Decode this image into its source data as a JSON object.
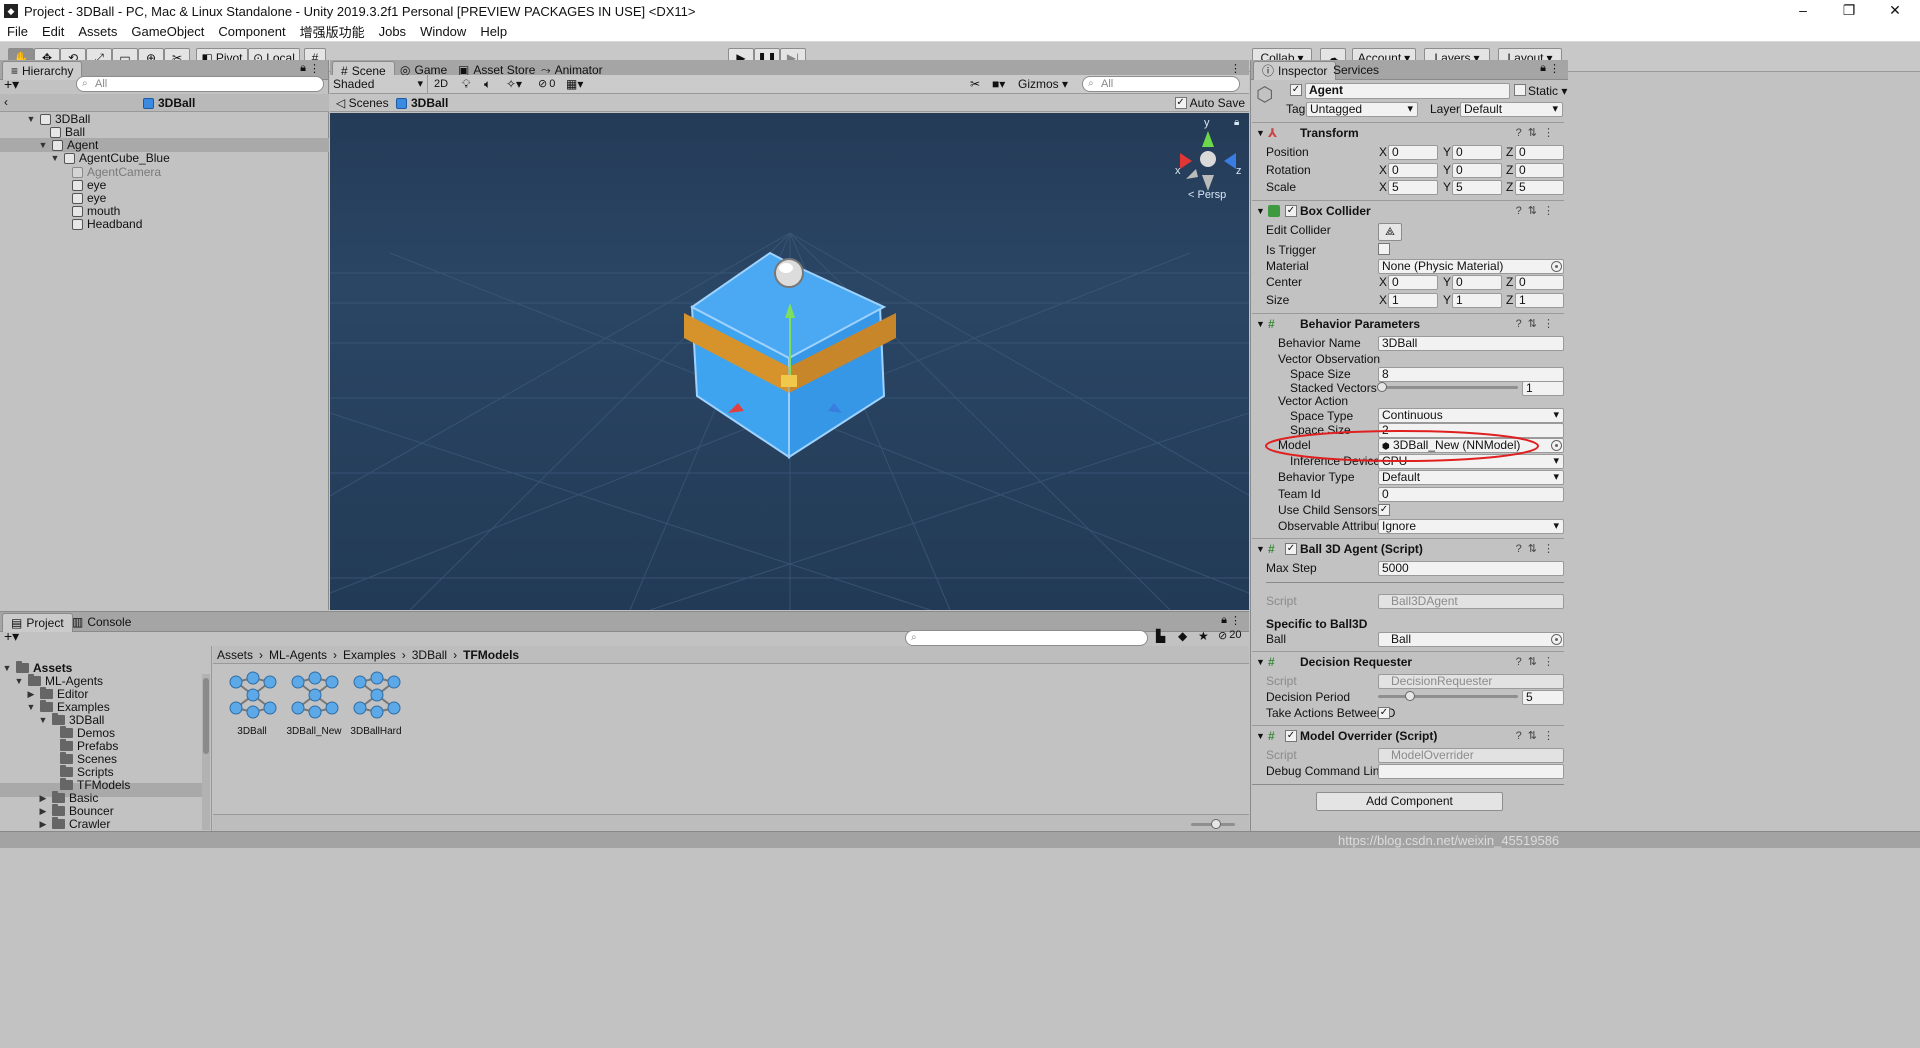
{
  "window": {
    "title": "Project - 3DBall - PC, Mac & Linux Standalone - Unity 2019.3.2f1 Personal [PREVIEW PACKAGES IN USE] <DX11>",
    "controls": [
      "–",
      "❐",
      "✕"
    ]
  },
  "menu": [
    "File",
    "Edit",
    "Assets",
    "GameObject",
    "Component",
    "增强版功能",
    "Jobs",
    "Window",
    "Help"
  ],
  "toolbar": {
    "pivot": "Pivot",
    "local": "Local",
    "collab": "Collab",
    "account": "Account",
    "layers": "Layers",
    "layout": "Layout"
  },
  "hierarchy": {
    "tab": "Hierarchy",
    "search_placeholder": "All",
    "scene_name": "3DBall",
    "rows": [
      {
        "label": "3DBall"
      },
      {
        "label": "Ball"
      },
      {
        "label": "Agent"
      },
      {
        "label": "AgentCube_Blue"
      },
      {
        "label": "AgentCamera"
      },
      {
        "label": "eye"
      },
      {
        "label": "eye"
      },
      {
        "label": "mouth"
      },
      {
        "label": "Headband"
      }
    ]
  },
  "scene": {
    "tabs": [
      "Scene",
      "Game",
      "Asset Store",
      "Animator"
    ],
    "shading": "Shaded",
    "mode2d": "2D",
    "hidden_count": "0",
    "gizmos": "Gizmos",
    "search_placeholder": "All",
    "breadcrumb_root": "Scenes",
    "breadcrumb_current": "3DBall",
    "autosave": "Auto Save",
    "persp": "< Persp",
    "axis_x": "x",
    "axis_y": "y",
    "axis_z": "z"
  },
  "project": {
    "tabs": [
      "Project",
      "Console"
    ],
    "hidden_count": "20",
    "breadcrumb": [
      "Assets",
      "ML-Agents",
      "Examples",
      "3DBall",
      "TFModels"
    ],
    "tree": [
      {
        "label": "Assets"
      },
      {
        "label": "ML-Agents"
      },
      {
        "label": "Editor"
      },
      {
        "label": "Examples"
      },
      {
        "label": "3DBall"
      },
      {
        "label": "Demos"
      },
      {
        "label": "Prefabs"
      },
      {
        "label": "Scenes"
      },
      {
        "label": "Scripts"
      },
      {
        "label": "TFModels"
      },
      {
        "label": "Basic"
      },
      {
        "label": "Bouncer"
      },
      {
        "label": "Crawler"
      }
    ],
    "assets": [
      {
        "label": "3DBall"
      },
      {
        "label": "3DBall_New"
      },
      {
        "label": "3DBallHard"
      }
    ]
  },
  "inspector": {
    "tabs": [
      "Inspector",
      "Services"
    ],
    "object_name": "Agent",
    "static_label": "Static",
    "tag_label": "Tag",
    "tag_value": "Untagged",
    "layer_label": "Layer",
    "layer_value": "Default",
    "transform": {
      "title": "Transform",
      "position_label": "Position",
      "position": [
        "0",
        "0",
        "0"
      ],
      "rotation_label": "Rotation",
      "rotation": [
        "0",
        "0",
        "0"
      ],
      "scale_label": "Scale",
      "scale": [
        "5",
        "5",
        "5"
      ]
    },
    "box_collider": {
      "title": "Box Collider",
      "edit_collider_label": "Edit Collider",
      "is_trigger_label": "Is Trigger",
      "material_label": "Material",
      "material_value": "None (Physic Material)",
      "center_label": "Center",
      "center": [
        "0",
        "0",
        "0"
      ],
      "size_label": "Size",
      "size": [
        "1",
        "1",
        "1"
      ]
    },
    "behavior_parameters": {
      "title": "Behavior Parameters",
      "behavior_name_label": "Behavior Name",
      "behavior_name": "3DBall",
      "vector_observation_label": "Vector Observation",
      "space_size_label": "Space Size",
      "space_size": "8",
      "stacked_vectors_label": "Stacked Vectors",
      "stacked_vectors": "1",
      "vector_action_label": "Vector Action",
      "space_type_label": "Space Type",
      "space_type": "Continuous",
      "action_space_size_label": "Space Size",
      "action_space_size": "2",
      "model_label": "Model",
      "model_value": "3DBall_New (NNModel)",
      "inference_device_label": "Inference Device",
      "inference_device": "CPU",
      "behavior_type_label": "Behavior Type",
      "behavior_type": "Default",
      "team_id_label": "Team Id",
      "team_id": "0",
      "use_child_sensors_label": "Use Child Sensors",
      "observable_attribute_label": "Observable Attribute",
      "observable_attribute": "Ignore"
    },
    "ball3d_agent": {
      "title": "Ball 3D Agent (Script)",
      "max_step_label": "Max Step",
      "max_step": "5000",
      "script_label": "Script",
      "script_value": "Ball3DAgent",
      "specific_header": "Specific to Ball3D",
      "ball_label": "Ball",
      "ball_value": "Ball"
    },
    "decision_requester": {
      "title": "Decision Requester",
      "script_label": "Script",
      "script_value": "DecisionRequester",
      "decision_period_label": "Decision Period",
      "decision_period": "5",
      "take_actions_label": "Take Actions Between D"
    },
    "model_overrider": {
      "title": "Model Overrider (Script)",
      "script_label": "Script",
      "script_value": "ModelOverrider",
      "debug_label": "Debug Command Line C"
    },
    "add_component": "Add Component"
  },
  "watermark": "https://blog.csdn.net/weixin_45519586",
  "colors": {
    "scene_bg": "#27415f",
    "cube_blue": "#3b9bec",
    "headband": "#d6932c",
    "highlight_ellipse": "#e02020"
  }
}
